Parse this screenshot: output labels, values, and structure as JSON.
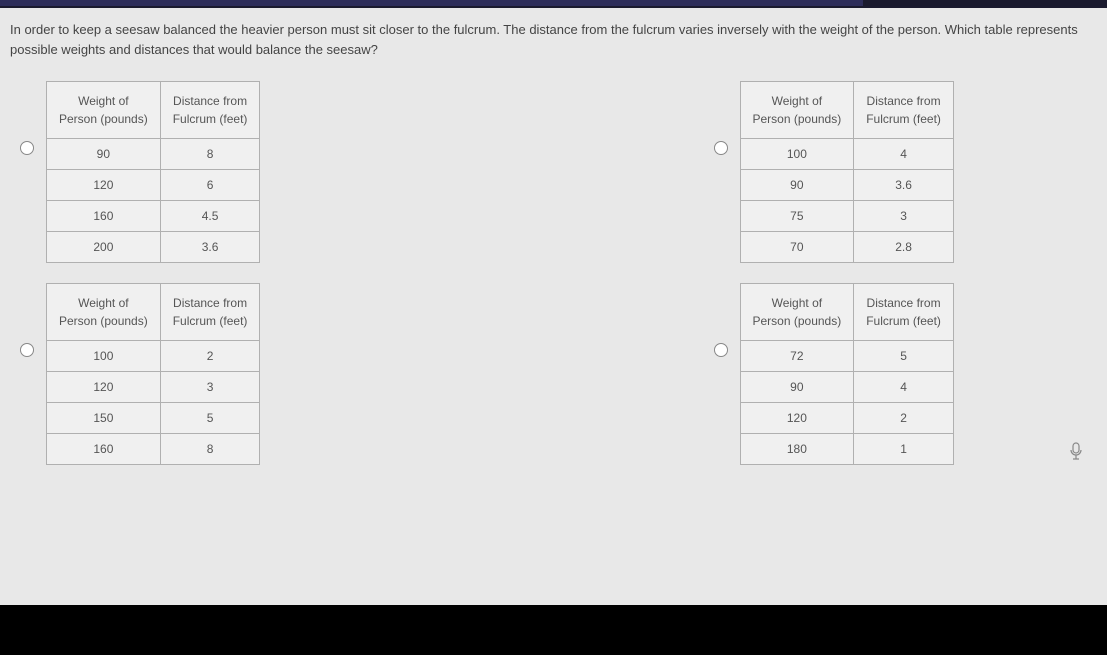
{
  "question": "In order to keep a seesaw balanced the heavier person must sit closer to the fulcrum. The distance from the fulcrum varies inversely with the weight of the person. Which table represents possible weights and distances that would balance the seesaw?",
  "headers": {
    "col1_line1": "Weight of",
    "col1_line2": "Person (pounds)",
    "col2_line1": "Distance from",
    "col2_line2": "Fulcrum (feet)"
  },
  "tables": {
    "a": {
      "rows": [
        {
          "w": "90",
          "d": "8"
        },
        {
          "w": "120",
          "d": "6"
        },
        {
          "w": "160",
          "d": "4.5"
        },
        {
          "w": "200",
          "d": "3.6"
        }
      ]
    },
    "b": {
      "rows": [
        {
          "w": "100",
          "d": "4"
        },
        {
          "w": "90",
          "d": "3.6"
        },
        {
          "w": "75",
          "d": "3"
        },
        {
          "w": "70",
          "d": "2.8"
        }
      ]
    },
    "c": {
      "rows": [
        {
          "w": "100",
          "d": "2"
        },
        {
          "w": "120",
          "d": "3"
        },
        {
          "w": "150",
          "d": "5"
        },
        {
          "w": "160",
          "d": "8"
        }
      ]
    },
    "d": {
      "rows": [
        {
          "w": "72",
          "d": "5"
        },
        {
          "w": "90",
          "d": "4"
        },
        {
          "w": "120",
          "d": "2"
        },
        {
          "w": "180",
          "d": "1"
        }
      ]
    }
  }
}
